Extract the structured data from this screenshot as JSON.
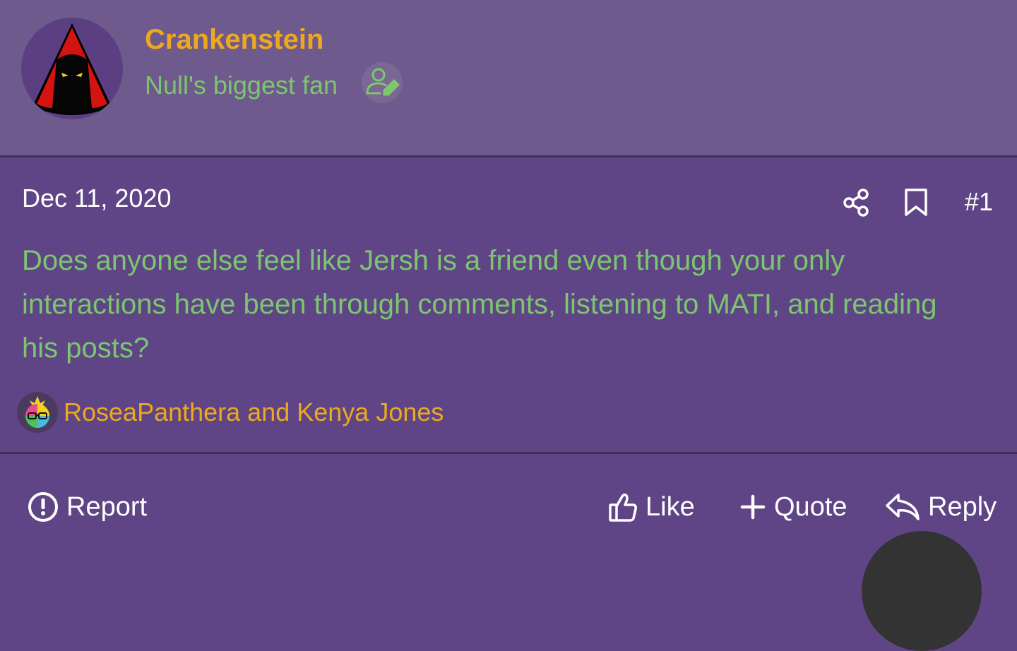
{
  "author": {
    "username": "Crankenstein",
    "user_title": "Null's biggest fan"
  },
  "post": {
    "date": "Dec 11, 2020",
    "number": "#1",
    "body": "Does anyone else feel like Jersh is a friend even though your only interactions have been through comments, listening to MATI, and reading his posts?"
  },
  "reactions": {
    "text": "RoseaPanthera and Kenya Jones"
  },
  "actions": {
    "report": "Report",
    "like": "Like",
    "quote": "Quote",
    "reply": "Reply"
  },
  "icons": {
    "share": "share-icon",
    "bookmark": "bookmark-icon",
    "report": "alert-circle-icon",
    "like": "thumbs-up-icon",
    "quote": "plus-icon",
    "reply": "reply-icon",
    "title_badge": "user-edit-icon"
  },
  "colors": {
    "background": "#5f4586",
    "header_background": "#6e5a8c",
    "username": "#eda91e",
    "body_text": "#7cc66f",
    "reaction_text": "#eda91e"
  }
}
